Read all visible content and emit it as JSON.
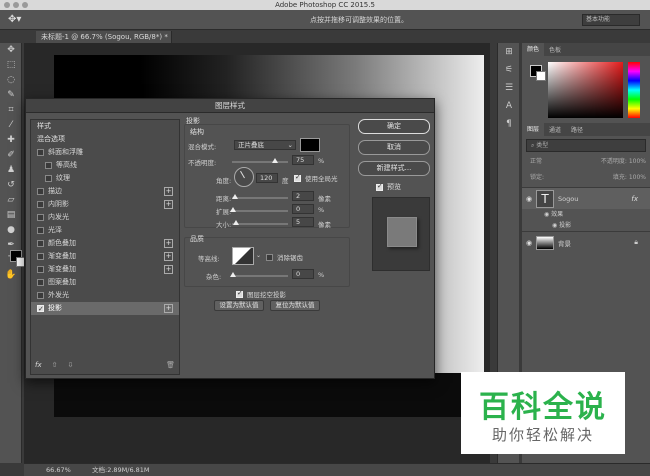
{
  "app": {
    "title": "Adobe Photoshop CC 2015.5"
  },
  "options": {
    "hint": "点按并拖移可调整效果的位置。",
    "workspace": "基本功能"
  },
  "document": {
    "tab": "未标题-1 @ 66.7% (Sogou, RGB/8*) *"
  },
  "status": {
    "zoom": "66.67%",
    "doc": "文档:2.89M/6.81M"
  },
  "panels": {
    "color_tabs": [
      "颜色",
      "色板"
    ],
    "layer_tabs": [
      "图层",
      "通道",
      "路径"
    ],
    "kind": "类型",
    "blend": "正常",
    "opacity_label": "不透明度:",
    "opacity": "100%",
    "lock_label": "锁定:",
    "fill_label": "填充:",
    "fill": "100%",
    "layers": [
      {
        "name": "Sogou",
        "fx": "fx"
      },
      {
        "name": "背景"
      }
    ],
    "effects_label": "效果",
    "drop_shadow_label": "投影"
  },
  "dialog": {
    "title": "图层样式",
    "list_header": "样式",
    "blend_options": "混合选项",
    "items": [
      {
        "label": "斜面和浮雕",
        "checked": false,
        "sub": false,
        "plus": false
      },
      {
        "label": "等高线",
        "checked": false,
        "sub": true,
        "plus": false
      },
      {
        "label": "纹理",
        "checked": false,
        "sub": true,
        "plus": false
      },
      {
        "label": "描边",
        "checked": false,
        "sub": false,
        "plus": true
      },
      {
        "label": "内阴影",
        "checked": false,
        "sub": false,
        "plus": true
      },
      {
        "label": "内发光",
        "checked": false,
        "sub": false,
        "plus": false
      },
      {
        "label": "光泽",
        "checked": false,
        "sub": false,
        "plus": false
      },
      {
        "label": "颜色叠加",
        "checked": false,
        "sub": false,
        "plus": true
      },
      {
        "label": "渐变叠加",
        "checked": false,
        "sub": false,
        "plus": true
      },
      {
        "label": "渐变叠加",
        "checked": false,
        "sub": false,
        "plus": true
      },
      {
        "label": "图案叠加",
        "checked": false,
        "sub": false,
        "plus": false
      },
      {
        "label": "外发光",
        "checked": false,
        "sub": false,
        "plus": false
      },
      {
        "label": "投影",
        "checked": true,
        "sub": false,
        "plus": true
      }
    ],
    "list_footer_fx": "fx",
    "drop_shadow": {
      "title": "投影",
      "structure": "结构",
      "blend_mode_label": "混合模式:",
      "blend_mode": "正片叠底",
      "opacity_label": "不透明度:",
      "opacity": "75",
      "percent": "%",
      "angle_label": "角度:",
      "angle": "120",
      "degree": "度",
      "global_light": "使用全局光",
      "distance_label": "距离:",
      "distance": "2",
      "spread_label": "扩展:",
      "spread": "0",
      "size_label": "大小:",
      "size": "5",
      "px": "像素",
      "quality": "品质",
      "contour_label": "等高线:",
      "anti_alias": "消除锯齿",
      "noise_label": "杂色:",
      "noise": "0",
      "knockout": "图层挖空投影",
      "make_default": "设置为默认值",
      "reset_default": "复位为默认值"
    },
    "buttons": {
      "ok": "确定",
      "cancel": "取消",
      "new_style": "新建样式...",
      "preview": "预览"
    }
  },
  "watermark": {
    "title": "百科全说",
    "subtitle": "助你轻松解决"
  },
  "colors": {
    "accent_green": "#2bb24c"
  }
}
